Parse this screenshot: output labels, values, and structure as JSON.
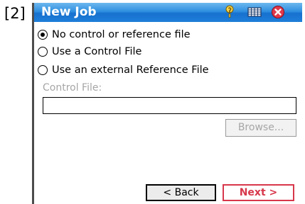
{
  "figure_tag": "[2]",
  "window": {
    "title": "New Job",
    "icons": [
      "help-icon",
      "keyboard-icon",
      "close-icon"
    ],
    "title_bar_color": "#2f8fe0",
    "close_color": "#d7374a"
  },
  "options": [
    {
      "label": "No control or reference file",
      "checked": true
    },
    {
      "label": "Use a Control File",
      "checked": false
    },
    {
      "label": "Use an external Reference File",
      "checked": false
    }
  ],
  "control_file": {
    "label": "Control File:",
    "value": "",
    "browse_label": "Browse..."
  },
  "footer": {
    "back_label": "< Back",
    "next_label": "Next >",
    "next_color": "#d7374a"
  }
}
